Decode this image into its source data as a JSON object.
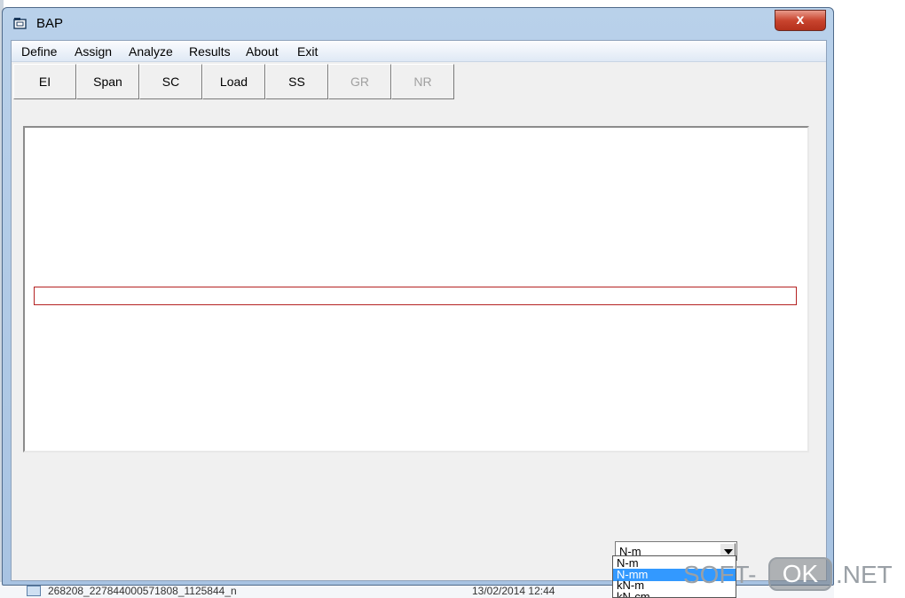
{
  "window": {
    "title": "BAP",
    "close_glyph": "x",
    "icon": "app-window-icon"
  },
  "menu": {
    "items": [
      "Define",
      "Assign",
      "Analyze",
      "Results",
      "About",
      "Exit"
    ]
  },
  "toolbar": {
    "buttons": [
      {
        "label": "EI",
        "enabled": true
      },
      {
        "label": "Span",
        "enabled": true
      },
      {
        "label": "SC",
        "enabled": true
      },
      {
        "label": "Load",
        "enabled": true
      },
      {
        "label": "SS",
        "enabled": true
      },
      {
        "label": "GR",
        "enabled": false
      },
      {
        "label": "NR",
        "enabled": false
      }
    ]
  },
  "units": {
    "selected": "N-m",
    "options": [
      "N-m",
      "N-mm",
      "kN-m",
      "kN-cm"
    ],
    "highlighted": "N-mm"
  },
  "background": {
    "file_name": "268208_227844000571808_1125844_n",
    "file_date": "13/02/2014 12:44"
  },
  "watermark": {
    "part1": "SOFT-",
    "part2": "OK",
    "part3": ".NET"
  },
  "colors": {
    "beam_outline": "#b42222",
    "highlight": "#3399ff",
    "close_button": "#c9452f"
  }
}
